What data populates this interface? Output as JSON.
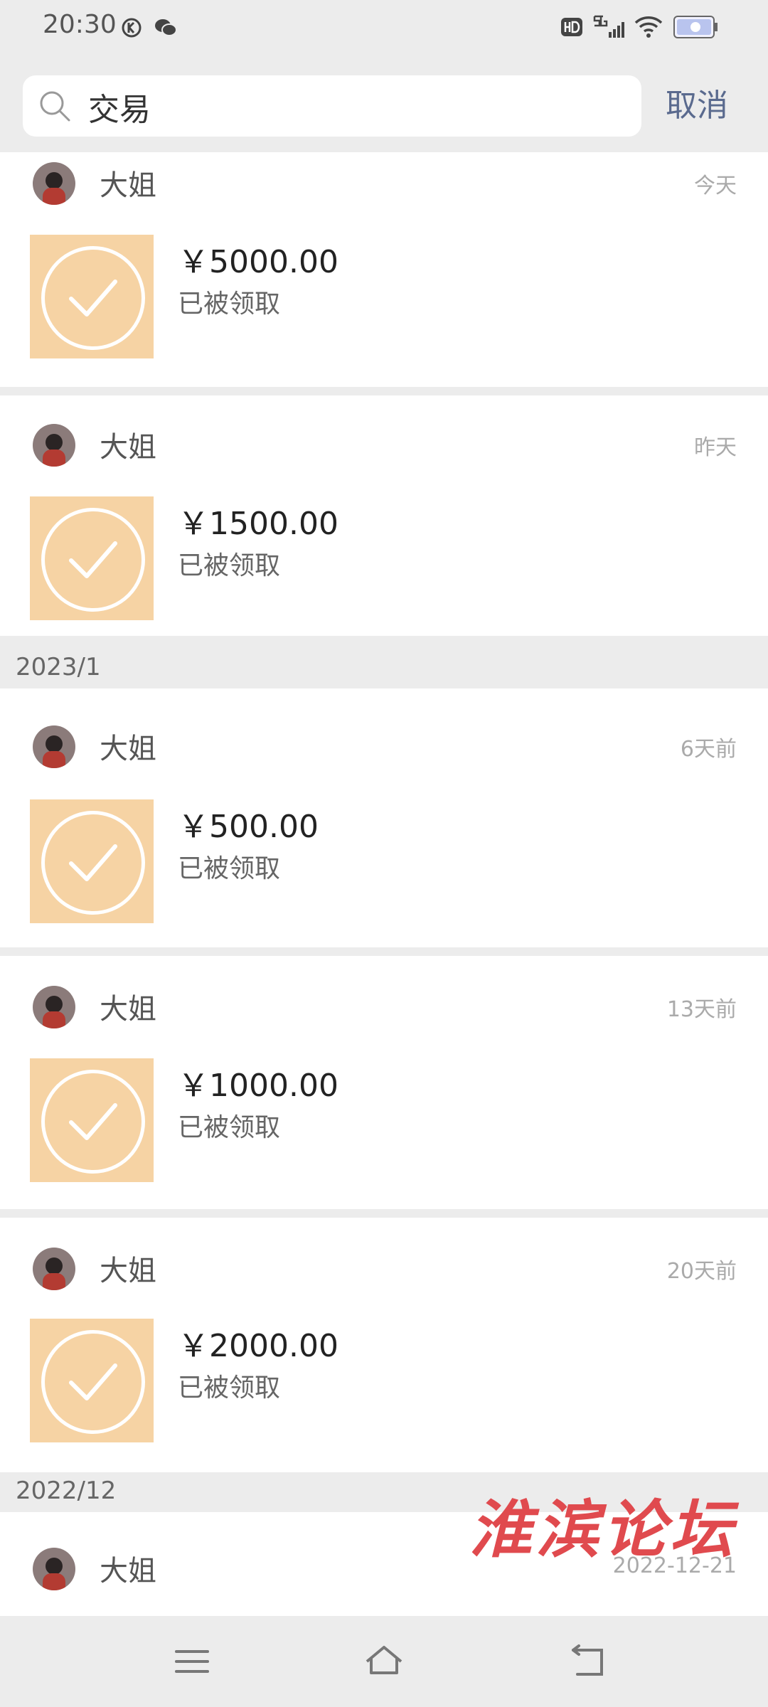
{
  "status_bar": {
    "time": "20:30"
  },
  "search": {
    "value": "交易",
    "cancel_label": "取消"
  },
  "sections": [
    {
      "label": ""
    },
    {
      "label": "2023/1"
    },
    {
      "label": "2022/12"
    }
  ],
  "transactions": [
    {
      "name": "大姐",
      "time": "今天",
      "amount": "￥5000.00",
      "status": "已被领取"
    },
    {
      "name": "大姐",
      "time": "昨天",
      "amount": "￥1500.00",
      "status": "已被领取"
    },
    {
      "name": "大姐",
      "time": "6天前",
      "amount": "￥500.00",
      "status": "已被领取"
    },
    {
      "name": "大姐",
      "time": "13天前",
      "amount": "￥1000.00",
      "status": "已被领取"
    },
    {
      "name": "大姐",
      "time": "20天前",
      "amount": "￥2000.00",
      "status": "已被领取"
    },
    {
      "name": "大姐",
      "time": "2022-12-21"
    }
  ],
  "watermark": "淮滨论坛",
  "icons": {
    "search": "search-icon",
    "check": "check-icon",
    "menu": "menu-icon",
    "home": "home-icon",
    "back": "back-icon"
  },
  "colors": {
    "accent": "#5a6a8e",
    "transfer_bg": "#f6d3a4",
    "watermark": "#e04a4e"
  }
}
